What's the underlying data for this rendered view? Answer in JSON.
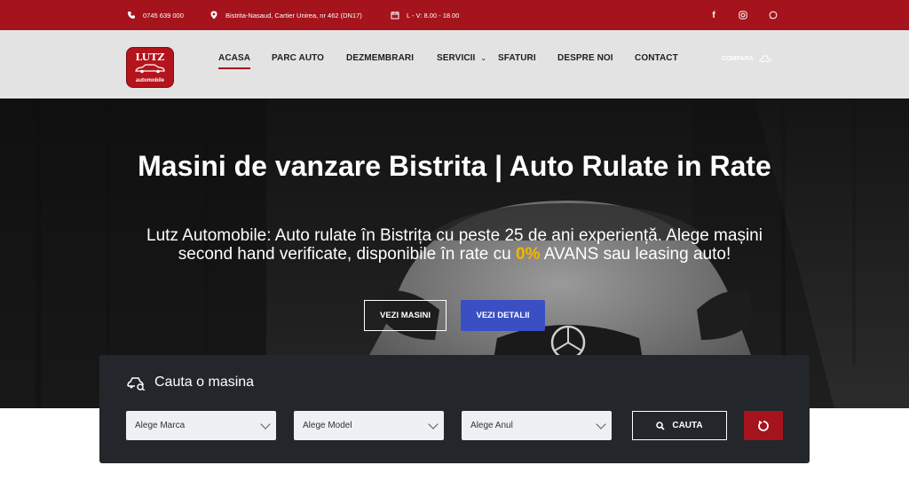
{
  "topbar": {
    "phone": "0745 639 000",
    "address": "Bistrita-Nasaud, Cartier Unirea, nr 462 (DN17)",
    "hours": "L - V: 8.00 - 18.00",
    "social": [
      "facebook-icon",
      "instagram-icon",
      "whatsapp-icon"
    ]
  },
  "logo": {
    "line1": "LUTZ",
    "line2": "automobile"
  },
  "nav": {
    "items": [
      "ACASA",
      "PARC AUTO",
      "DEZMEMBRARI",
      "SERVICII",
      "SFATURI",
      "DESPRE NOI",
      "CONTACT"
    ],
    "active": "ACASA",
    "compare": "COMPARA"
  },
  "hero": {
    "title": "Masini de vanzare Bistrita | Auto Rulate in Rate",
    "sub_before": "Lutz Automobile: Auto rulate în Bistrița cu peste 25 de ani experiență. Alege mașini second hand verificate, disponibile în rate cu ",
    "sub_highlight": "0%",
    "sub_after": " AVANS sau leasing auto!",
    "btn_primary": "VEZI MASINI",
    "btn_secondary": "VEZI DETALII"
  },
  "search": {
    "title": "Cauta o masina",
    "marca": "Alege Marca",
    "model": "Alege Model",
    "anul": "Alege Anul",
    "button": "CAUTA"
  },
  "colors": {
    "brand_red": "#a5141c",
    "accent_blue": "#3b4fc4",
    "highlight": "#f5b400",
    "panel": "#23262a"
  }
}
